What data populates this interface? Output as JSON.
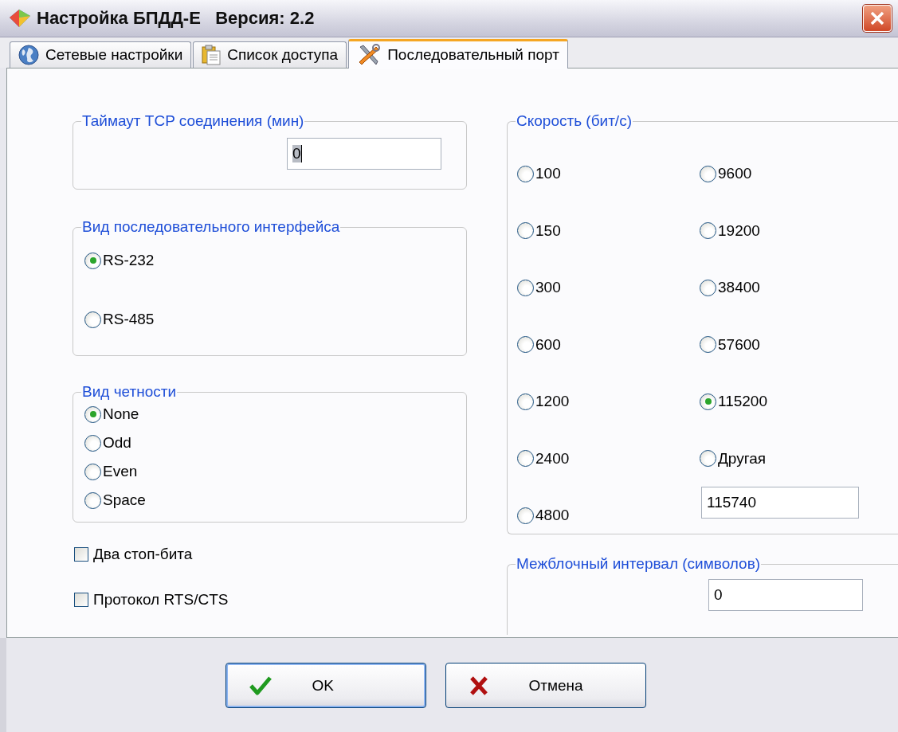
{
  "window": {
    "title": "Настройка БПДД-Е   Версия: 2.2"
  },
  "tabs": [
    {
      "label": "Сетевые настройки",
      "selected": false
    },
    {
      "label": "Список доступа",
      "selected": false
    },
    {
      "label": "Последовательный порт",
      "selected": true
    }
  ],
  "timeout": {
    "title": "Таймаут TCP соединения (мин)",
    "value": "0"
  },
  "interface": {
    "title": "Вид последовательного интерфейса",
    "options": [
      {
        "label": "RS-232",
        "selected": true
      },
      {
        "label": "RS-485",
        "selected": false
      }
    ]
  },
  "parity": {
    "title": "Вид четности",
    "options": [
      {
        "label": "None",
        "selected": true
      },
      {
        "label": "Odd",
        "selected": false
      },
      {
        "label": "Even",
        "selected": false
      },
      {
        "label": "Space",
        "selected": false
      }
    ]
  },
  "checkboxes": [
    {
      "label": "Два стоп-бита",
      "checked": false
    },
    {
      "label": "Протокол RTS/CTS",
      "checked": false
    }
  ],
  "speed": {
    "title": "Скорость (бит/с)",
    "options": [
      {
        "label": "100",
        "selected": false
      },
      {
        "label": "150",
        "selected": false
      },
      {
        "label": "300",
        "selected": false
      },
      {
        "label": "600",
        "selected": false
      },
      {
        "label": "1200",
        "selected": false
      },
      {
        "label": "2400",
        "selected": false
      },
      {
        "label": "4800",
        "selected": false
      },
      {
        "label": "9600",
        "selected": false
      },
      {
        "label": "19200",
        "selected": false
      },
      {
        "label": "38400",
        "selected": false
      },
      {
        "label": "57600",
        "selected": false
      },
      {
        "label": "115200",
        "selected": true
      },
      {
        "label": "Другая",
        "selected": false
      }
    ],
    "custom_value": "115740"
  },
  "interval": {
    "title": "Межблочный интервал (символов)",
    "value": "0"
  },
  "buttons": [
    {
      "label": "OK",
      "kind": "ok"
    },
    {
      "label": "Отмена",
      "kind": "cancel"
    }
  ]
}
